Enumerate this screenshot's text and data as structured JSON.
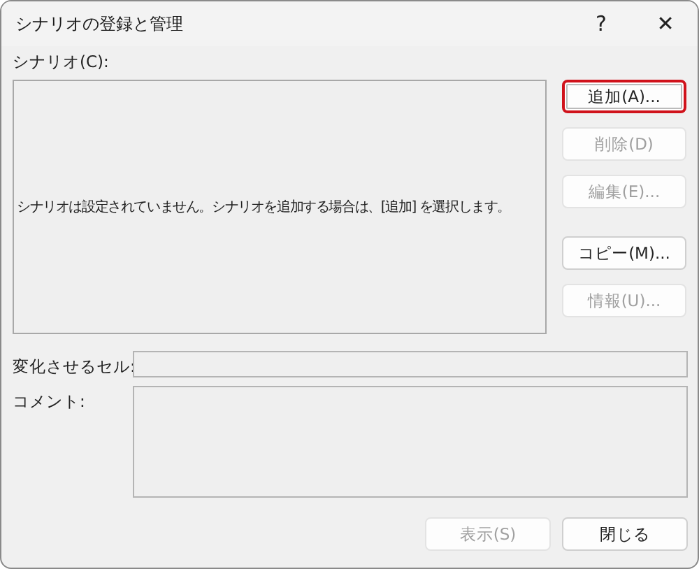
{
  "window": {
    "title": "シナリオの登録と管理",
    "help": "?",
    "close": "✕"
  },
  "scenarios": {
    "label": "シナリオ(C):",
    "message": "シナリオは設定されていません。シナリオを追加する場合は、[追加] を選択します。"
  },
  "side_buttons": [
    {
      "label": "追加(A)...",
      "disabled": false,
      "highlighted": true
    },
    {
      "label": "削除(D)",
      "disabled": true,
      "highlighted": false
    },
    {
      "label": "編集(E)...",
      "disabled": true,
      "highlighted": false
    },
    {
      "label": "コピー(M)...",
      "disabled": false,
      "highlighted": false
    },
    {
      "label": "情報(U)...",
      "disabled": true,
      "highlighted": false
    }
  ],
  "changing_cells": {
    "label": "変化させるセル:"
  },
  "comment": {
    "label": "コメント:"
  },
  "footer_buttons": [
    {
      "label": "表示(S)",
      "disabled": true
    },
    {
      "label": "閉じる",
      "disabled": false
    }
  ]
}
